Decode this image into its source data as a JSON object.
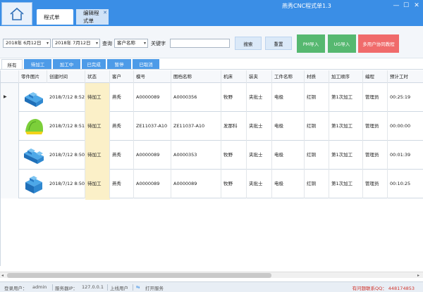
{
  "window": {
    "app_title": "燕秀CNC程式单1.3",
    "tabs": [
      {
        "label": "程式单",
        "active": true
      },
      {
        "label": "编辑程式单",
        "active": false
      }
    ],
    "controls": {
      "minimize": "—",
      "maximize": "☐",
      "close": "✕"
    }
  },
  "filters": {
    "date_from": "2018年 6月12日",
    "date_to": "2018年 7月12日",
    "query_label": "查询",
    "query_field": "客户名称",
    "keyword_label": "关键字",
    "keyword_value": "",
    "search_button": "搜索",
    "reset_button": "重置",
    "pm_import": "PM导入",
    "ug_import": "UG导入",
    "multi_user_tutorial": "多用户协同教程"
  },
  "status_tabs": [
    "所有",
    "待加工",
    "加工中",
    "已完成",
    "暂停",
    "已取消"
  ],
  "table": {
    "columns": [
      "零件图片",
      "创建时间",
      "状态",
      "客户",
      "模号",
      "图档名称",
      "机床",
      "装夹",
      "工件名称",
      "材质",
      "加工顺序",
      "编程",
      "预计工时"
    ],
    "rows": [
      {
        "created": "2018/7/12 8:52",
        "status": "待加工",
        "customer": "燕秀",
        "mold": "A0000089",
        "file": "A0000356",
        "machine": "牧野",
        "clamp": "夹批士",
        "part": "电极",
        "material": "红铜",
        "order": "第1次加工",
        "programmer": "管理员",
        "hours": "00:25:19",
        "thumb": "blue-block"
      },
      {
        "created": "2018/7/12 8:51",
        "status": "待加工",
        "customer": "燕秀",
        "mold": "ZE11037-A10",
        "file": "ZE11037-A10",
        "machine": "发那科",
        "clamp": "夹批士",
        "part": "电极",
        "material": "红铜",
        "order": "第1次加工",
        "programmer": "管理员",
        "hours": "00:00:00",
        "thumb": "green-dome"
      },
      {
        "created": "2018/7/12 8:50",
        "status": "待加工",
        "customer": "燕秀",
        "mold": "A0000089",
        "file": "A0000353",
        "machine": "牧野",
        "clamp": "夹批士",
        "part": "电极",
        "material": "红铜",
        "order": "第1次加工",
        "programmer": "管理员",
        "hours": "00:01:39",
        "thumb": "blue-stepped"
      },
      {
        "created": "2018/7/12 8:50",
        "status": "待加工",
        "customer": "燕秀",
        "mold": "A0000089",
        "file": "A0000089",
        "machine": "牧野",
        "clamp": "夹批士",
        "part": "电极",
        "material": "红铜",
        "order": "第1次加工",
        "programmer": "管理员",
        "hours": "00:10:25",
        "thumb": "blue-cube"
      }
    ]
  },
  "statusbar": {
    "login_label": "登录用户：",
    "login_user": "admin",
    "server_label": "服务器IP：",
    "server_ip": "127.0.0.1",
    "online_label": "上线用户",
    "open_service": "打开服务",
    "contact": "有问题联系QQ： 448174853"
  },
  "colors": {
    "titlebar": "#3a8ee6",
    "status_highlight": "#fbf0c8",
    "green_button": "#56b870",
    "red_button": "#f06b6b",
    "contact_text": "#d0342c"
  }
}
